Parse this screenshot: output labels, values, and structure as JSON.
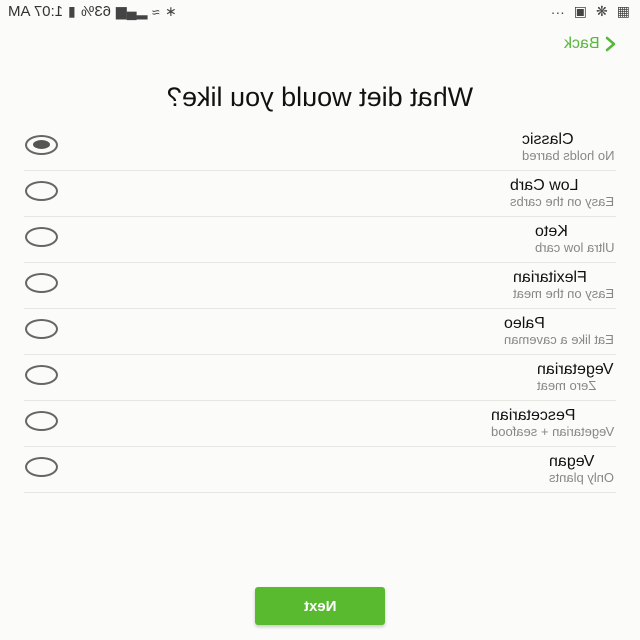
{
  "status_bar": {
    "time": "1:07 AM",
    "battery": "63%",
    "icons": [
      "battery-icon",
      "signal-icon",
      "wifi-icon",
      "bluetooth-icon",
      "more-icon",
      "photo-icon",
      "fan-icon",
      "gallery-icon"
    ]
  },
  "nav": {
    "back_label": "Back"
  },
  "title": "What diet would you like?",
  "options": [
    {
      "name": "Classic",
      "desc": "No holds barred",
      "selected": true
    },
    {
      "name": "Low Carb",
      "desc": "Easy on the carbs",
      "selected": false
    },
    {
      "name": "Keto",
      "desc": "Ultra low carb",
      "selected": false
    },
    {
      "name": "Flexitarian",
      "desc": "Easy on the meat",
      "selected": false
    },
    {
      "name": "Paleo",
      "desc": "Eat like a caveman",
      "selected": false
    },
    {
      "name": "Vegetarian",
      "desc": "Zero meat",
      "selected": false
    },
    {
      "name": "Pescetarian",
      "desc": "Vegetarian + seafood",
      "selected": false
    },
    {
      "name": "Vegan",
      "desc": "Only plants",
      "selected": false
    }
  ],
  "next_label": "Next",
  "colors": {
    "accent": "#5aba2f",
    "back_link": "#55b83a",
    "radio": "#666666"
  }
}
